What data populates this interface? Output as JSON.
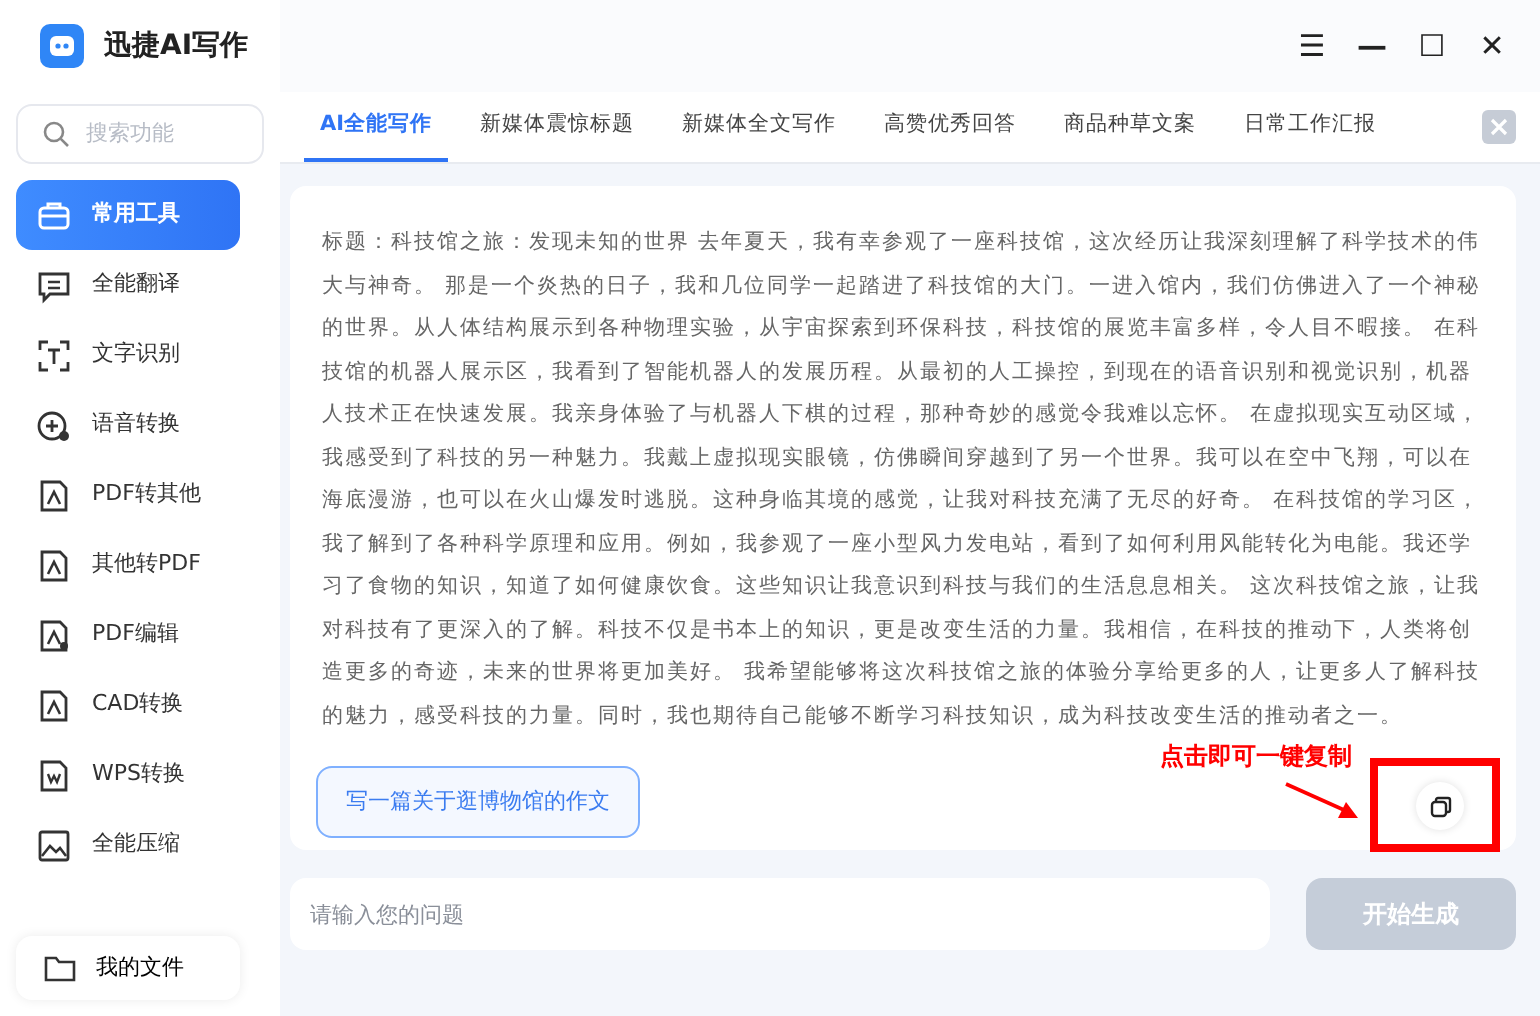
{
  "app": {
    "title": "迅捷AI写作"
  },
  "window_controls": [
    "☰",
    "—",
    "☐",
    "✕"
  ],
  "sidebar": {
    "search": {
      "placeholder": "搜索功能"
    },
    "items": [
      {
        "label": "常用工具",
        "selected": true
      },
      {
        "label": "全能翻译",
        "selected": false
      },
      {
        "label": "文字识别",
        "selected": false
      },
      {
        "label": "语音转换",
        "selected": false
      },
      {
        "label": "PDF转其他",
        "selected": false
      },
      {
        "label": "其他转PDF",
        "selected": false
      },
      {
        "label": "PDF编辑",
        "selected": false
      },
      {
        "label": "CAD转换",
        "selected": false
      },
      {
        "label": "WPS转换",
        "selected": false
      },
      {
        "label": "全能压缩",
        "selected": false
      }
    ],
    "files": "我的文件"
  },
  "tabs": [
    {
      "label": "AI全能写作",
      "selected": true
    },
    {
      "label": "新媒体震惊标题",
      "selected": false
    },
    {
      "label": "新媒体全文写作",
      "selected": false
    },
    {
      "label": "高赞优秀回答",
      "selected": false
    },
    {
      "label": "商品种草文案",
      "selected": false
    },
    {
      "label": "日常工作汇报",
      "selected": false
    }
  ],
  "result": {
    "text": "标题：科技馆之旅：发现未知的世界 去年夏天，我有幸参观了一座科技馆，这次经历让我深刻理解了科学技术的伟大与神奇。 那是一个炎热的日子，我和几位同学一起踏进了科技馆的大门。一进入馆内，我们仿佛进入了一个神秘的世界。从人体结构展示到各种物理实验，从宇宙探索到环保科技，科技馆的展览丰富多样，令人目不暇接。 在科技馆的机器人展示区，我看到了智能机器人的发展历程。从最初的人工操控，到现在的语音识别和视觉识别，机器人技术正在快速发展。我亲身体验了与机器人下棋的过程，那种奇妙的感觉令我难以忘怀。 在虚拟现实互动区域，我感受到了科技的另一种魅力。我戴上虚拟现实眼镜，仿佛瞬间穿越到了另一个世界。我可以在空中飞翔，可以在海底漫游，也可以在火山爆发时逃脱。这种身临其境的感觉，让我对科技充满了无尽的好奇。 在科技馆的学习区，我了解到了各种科学原理和应用。例如，我参观了一座小型风力发电站，看到了如何利用风能转化为电能。我还学习了食物的知识，知道了如何健康饮食。这些知识让我意识到科技与我们的生活息息相关。 这次科技馆之旅，让我对科技有了更深入的了解。科技不仅是书本上的知识，更是改变生活的力量。我相信，在科技的推动下，人类将创造更多的奇迹，未来的世界将更加美好。 我希望能够将这次科技馆之旅的体验分享给更多的人，让更多人了解科技的魅力，感受科技的力量。同时，我也期待自己能够不断学习科技知识，成为科技改变生活的推动者之一。",
    "prompt_chip": "写一篇关于逛博物馆的作文"
  },
  "annotation": {
    "text": "点击即可一键复制"
  },
  "input": {
    "placeholder": "请输入您的问题"
  },
  "generate_button": {
    "label": "开始生成",
    "disabled": true
  }
}
